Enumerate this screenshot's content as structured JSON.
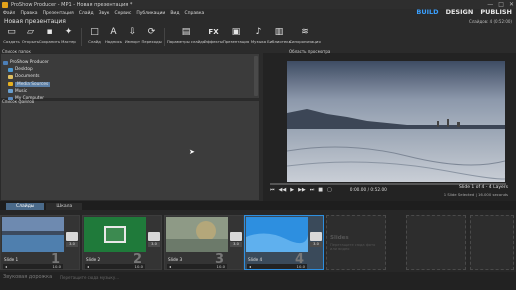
{
  "window": {
    "title": "ProShow Producer - MP1 - Новая презентация *",
    "controls": [
      "—",
      "□",
      "✕"
    ]
  },
  "menu": [
    "Файл",
    "Правка",
    "Презентация",
    "Слайд",
    "Звук",
    "Сервис",
    "Публикации",
    "Вид",
    "Справка"
  ],
  "modes": [
    "BUILD",
    "DESIGN",
    "PUBLISH"
  ],
  "project": {
    "title": "Новая презентация",
    "meta": "Слайдов: 4 (0:52:00)"
  },
  "toolbar": [
    {
      "label": "Создать",
      "icon": "new-icon"
    },
    {
      "label": "Открыть",
      "icon": "open-icon"
    },
    {
      "label": "Сохранить",
      "icon": "save-icon"
    },
    {
      "label": "Мастер",
      "icon": "wizard-icon"
    },
    {
      "label": "Слайд",
      "icon": "slide-icon"
    },
    {
      "label": "Надпись",
      "icon": "caption-icon"
    },
    {
      "label": "Импорт",
      "icon": "import-icon"
    },
    {
      "label": "Переходы",
      "icon": "transition-icon"
    },
    {
      "label": "Параметры слайда",
      "icon": "slide-options-icon"
    },
    {
      "label": "Эффекты",
      "icon": "fx-icon"
    },
    {
      "label": "Презентация",
      "icon": "show-icon"
    },
    {
      "label": "Музыка",
      "icon": "music-icon"
    },
    {
      "label": "Библиотека",
      "icon": "library-icon"
    },
    {
      "label": "Синхронизация",
      "icon": "sync-icon"
    }
  ],
  "folders": {
    "header": "Список папок",
    "items": [
      "ProShow Producer",
      "Desktop",
      "Documents",
      "Media Sources",
      "Music",
      "My Computer"
    ],
    "selected": 3
  },
  "files": {
    "header": "Список файлов"
  },
  "preview": {
    "header": "Область просмотра",
    "time": "0:00.00 / 0:52.00",
    "slide_info": "Slide 1 of 4 - 4 Layers",
    "slide_info2": "1 Slide Selected | 16.000 seconds"
  },
  "tabs": [
    "Слайды",
    "Шкала"
  ],
  "slides": [
    {
      "name": "Slide 1",
      "num": "1",
      "duration": "10.0",
      "trans": "3.0"
    },
    {
      "name": "Slide 2",
      "num": "2",
      "duration": "10.0",
      "trans": "3.0"
    },
    {
      "name": "Slide 3",
      "num": "3",
      "duration": "10.0",
      "trans": "3.0"
    },
    {
      "name": "Slide 4",
      "num": "4",
      "duration": "10.0",
      "trans": "3.0"
    }
  ],
  "slides_hint": {
    "title": "Slides",
    "text": "Перетащите сюда фото или видео"
  },
  "soundtrack": {
    "label": "Звуковая дорожка",
    "hint": "Перетащите сюда музыку..."
  },
  "colors": {
    "accent": "#3aa0ff",
    "selected_slide": "#2d8fe0"
  }
}
